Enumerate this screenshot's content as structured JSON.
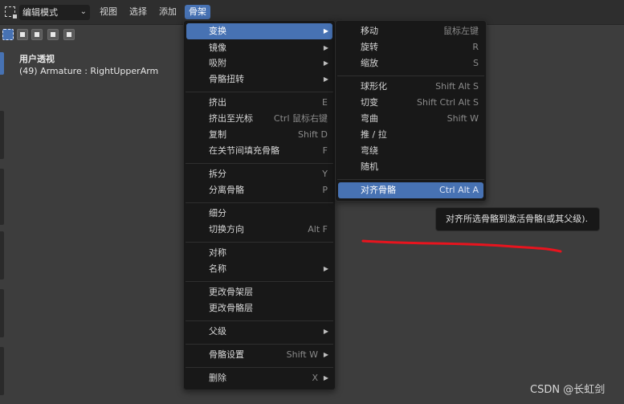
{
  "header": {
    "mode": "编辑模式",
    "menus": [
      "视图",
      "选择",
      "添加",
      "骨架"
    ]
  },
  "viewport": {
    "title": "用户透视",
    "object": "(49) Armature : RightUpperArm"
  },
  "armature_menu": {
    "items": [
      {
        "label": "变换",
        "shortcut": "",
        "submenu": true,
        "highlighted": true
      },
      {
        "label": "镜像",
        "shortcut": "",
        "submenu": true
      },
      {
        "label": "吸附",
        "shortcut": "",
        "submenu": true
      },
      {
        "label": "骨骼扭转",
        "shortcut": "",
        "submenu": true
      },
      {
        "label": "挤出",
        "shortcut": "E"
      },
      {
        "label": "挤出至光标",
        "shortcut": "Ctrl 鼠标右键"
      },
      {
        "label": "复制",
        "shortcut": "Shift D"
      },
      {
        "label": "在关节间填充骨骼",
        "shortcut": "F"
      },
      {
        "label": "拆分",
        "shortcut": "Y"
      },
      {
        "label": "分离骨骼",
        "shortcut": "P"
      },
      {
        "label": "细分",
        "shortcut": ""
      },
      {
        "label": "切换方向",
        "shortcut": "Alt F"
      },
      {
        "label": "对称",
        "shortcut": ""
      },
      {
        "label": "名称",
        "shortcut": "",
        "submenu": true
      },
      {
        "label": "更改骨架层",
        "shortcut": ""
      },
      {
        "label": "更改骨骼层",
        "shortcut": ""
      },
      {
        "label": "父级",
        "shortcut": "",
        "submenu": true
      },
      {
        "label": "骨骼设置",
        "shortcut": "Shift W",
        "submenu": true
      },
      {
        "label": "删除",
        "shortcut": "X",
        "submenu": true
      }
    ]
  },
  "transform_submenu": {
    "items": [
      {
        "label": "移动",
        "shortcut": "鼠标左键"
      },
      {
        "label": "旋转",
        "shortcut": "R"
      },
      {
        "label": "缩放",
        "shortcut": "S"
      },
      {
        "label": "球形化",
        "shortcut": "Shift Alt S"
      },
      {
        "label": "切变",
        "shortcut": "Shift Ctrl Alt S"
      },
      {
        "label": "弯曲",
        "shortcut": "Shift W"
      },
      {
        "label": "推 / 拉",
        "shortcut": ""
      },
      {
        "label": "弯绕",
        "shortcut": ""
      },
      {
        "label": "随机",
        "shortcut": ""
      },
      {
        "label": "对齐骨骼",
        "shortcut": "Ctrl Alt A",
        "highlighted": true
      }
    ]
  },
  "tooltip": "对齐所选骨骼到激活骨骼(或其父级).",
  "watermark": "CSDN @长虹剑",
  "colors": {
    "accent": "#4772b3",
    "menu_bg": "#181818",
    "viewport_bg": "#3d3d3d",
    "annotation": "#e8141e"
  }
}
